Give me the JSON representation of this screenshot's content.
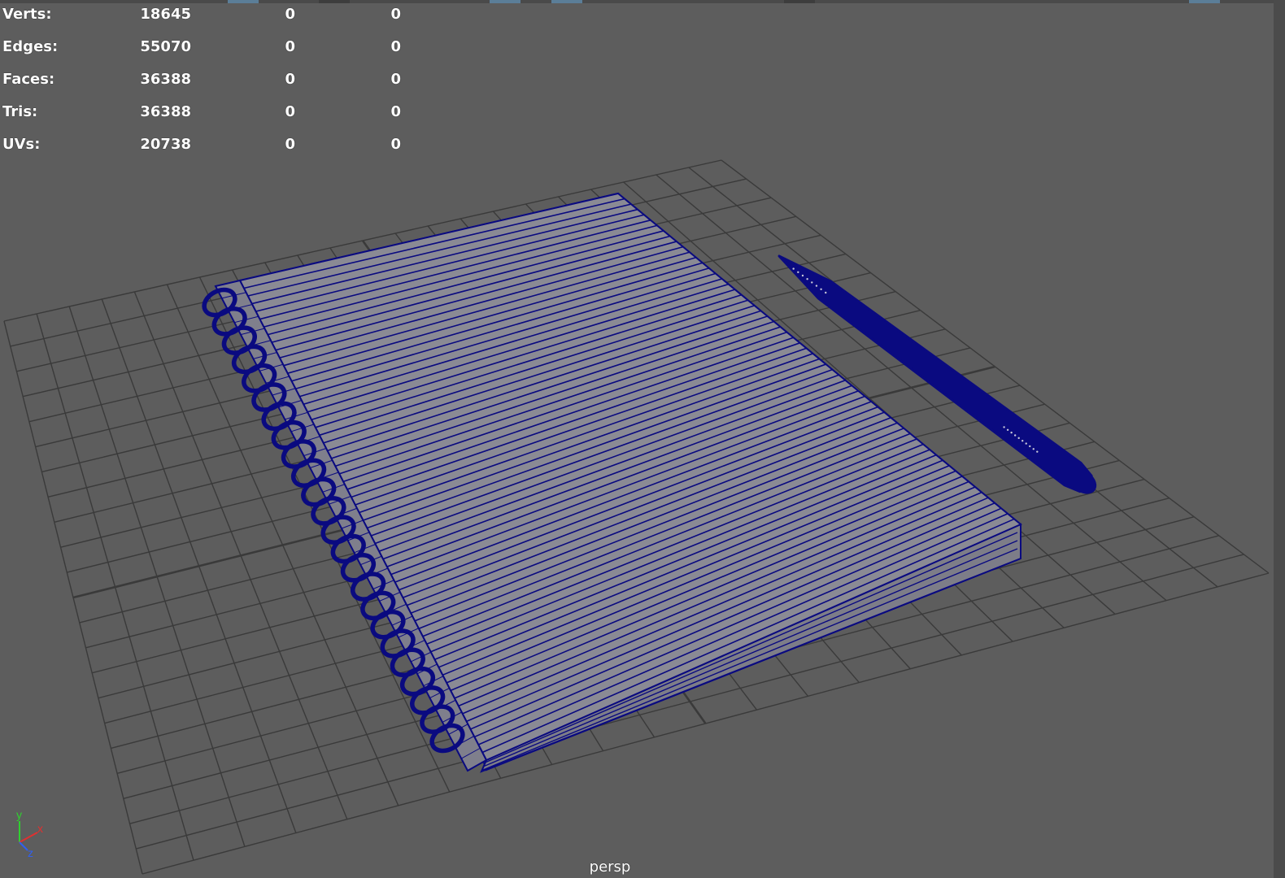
{
  "hud": {
    "rows": [
      {
        "label": "Verts:",
        "total": "18645",
        "selected": "0",
        "component": "0"
      },
      {
        "label": "Edges:",
        "total": "55070",
        "selected": "0",
        "component": "0"
      },
      {
        "label": "Faces:",
        "total": "36388",
        "selected": "0",
        "component": "0"
      },
      {
        "label": "Tris:",
        "total": "36388",
        "selected": "0",
        "component": "0"
      },
      {
        "label": "UVs:",
        "total": "20738",
        "selected": "0",
        "component": "0"
      }
    ]
  },
  "camera": {
    "name": "persp"
  },
  "axis": {
    "x": "x",
    "y": "y",
    "z": "z"
  },
  "colors": {
    "background": "#5d5d5d",
    "grid": "#3a3a3a",
    "wireframe": "#0a0a80",
    "wire_fill": "#8a8a94",
    "hud_text": "#ffffff",
    "axis_x": "#e03030",
    "axis_y": "#30d030",
    "axis_z": "#3060f0"
  },
  "icons": {
    "axis": "axis-gizmo-icon"
  }
}
